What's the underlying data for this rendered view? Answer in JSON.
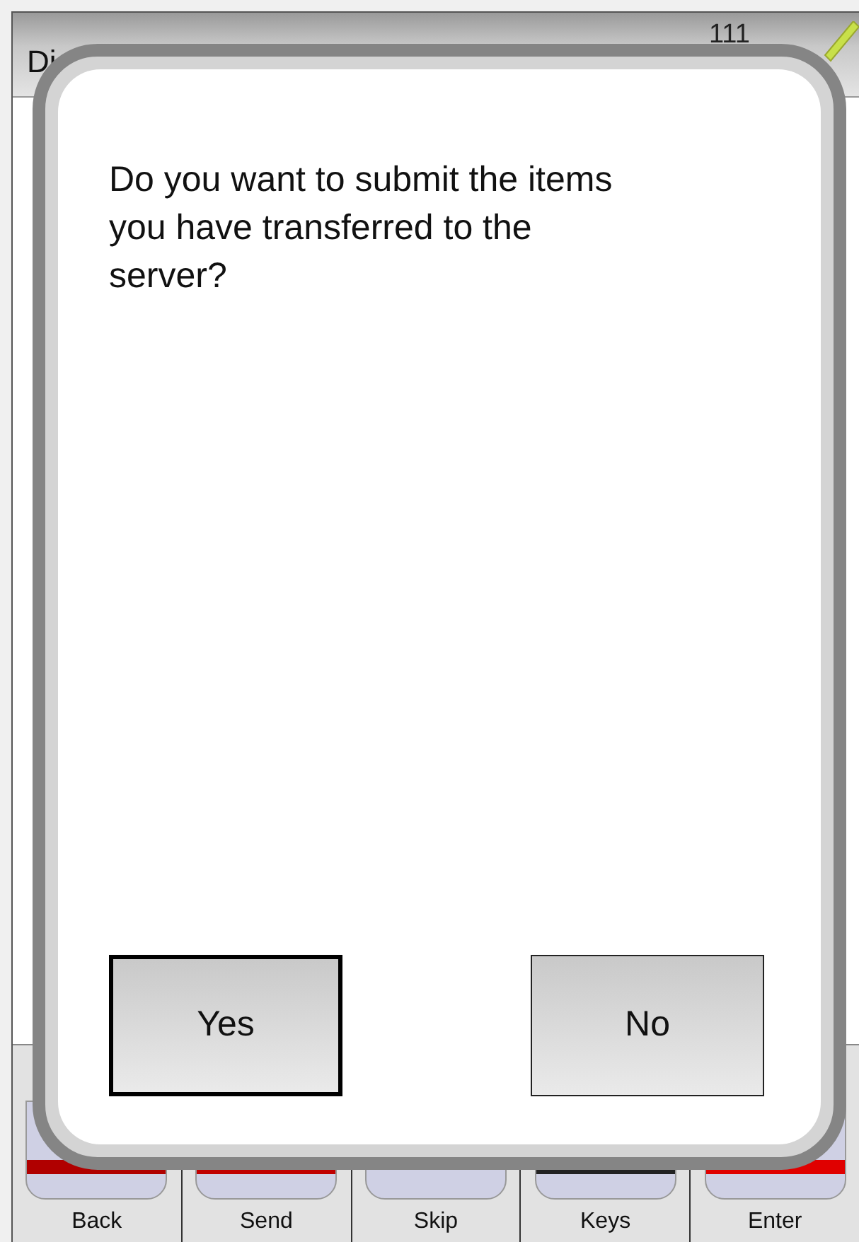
{
  "header": {
    "title": "Di",
    "count": "111"
  },
  "dialog": {
    "message": "Do you want to submit the items you have transferred to the server?",
    "buttons": [
      {
        "label": "Yes",
        "focused": true
      },
      {
        "label": "No",
        "focused": false
      }
    ]
  },
  "toolbar": [
    {
      "label": "Back",
      "kind": "back"
    },
    {
      "label": "Send",
      "kind": "send"
    },
    {
      "label": "Skip",
      "kind": "skip"
    },
    {
      "label": "Keys",
      "kind": "keys"
    },
    {
      "label": "Enter",
      "kind": "enter"
    }
  ]
}
